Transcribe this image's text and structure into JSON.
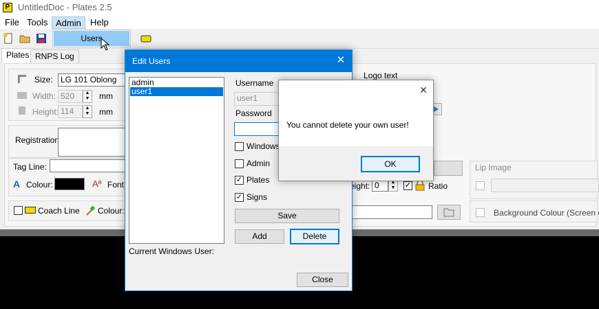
{
  "app": {
    "icon_letter": "P",
    "title": "UntitledDoc - Plates 2.5"
  },
  "menu": {
    "items": [
      "File",
      "Tools",
      "Admin",
      "Help"
    ],
    "admin_dropdown": [
      "Users"
    ]
  },
  "tabs": [
    "Plates",
    "RNPS Log"
  ],
  "form": {
    "size_label": "Size:",
    "size_value": "LG 101 Oblong",
    "width_label": "Width:",
    "width_value": "520",
    "height_label": "Height:",
    "height_value": "114",
    "unit_mm": "mm",
    "registration_label": "Registration:",
    "tagline_label": "Tag Line:",
    "colour_label": "Colour:",
    "font_label": "Font:",
    "coach_line_label": "Coach Line",
    "colour2_label": "Colour:",
    "logo_text_label": "Logo text",
    "logo_height_label": "eight:",
    "logo_height_value": "0",
    "ratio_label": "Ratio",
    "lip_image_label": "Lip Image",
    "background_colour_label": "Background Colour (Screen onl"
  },
  "edit_users": {
    "title": "Edit Users",
    "users": [
      "admin",
      "user1"
    ],
    "selected_index": 1,
    "username_label": "Username",
    "username_value": "user1",
    "password_label": "Password",
    "windows_label": "Windows",
    "admin_label": "Admin",
    "plates_label": "Plates",
    "signs_label": "Signs",
    "save_button": "Save",
    "add_button": "Add",
    "delete_button": "Delete",
    "current_windows_user_label": "Current Windows User:",
    "close_button": "Close",
    "checked": {
      "windows": false,
      "admin": false,
      "plates": true,
      "signs": true
    }
  },
  "message_box": {
    "text": "You cannot delete your own user!",
    "ok_button": "OK"
  },
  "glyphs": {
    "close": "✕",
    "check": "✓",
    "spin_up": "▲",
    "spin_down": "▼"
  },
  "colors": {
    "accent": "#0078d7",
    "tagline_colour_swatch": "#000000"
  }
}
